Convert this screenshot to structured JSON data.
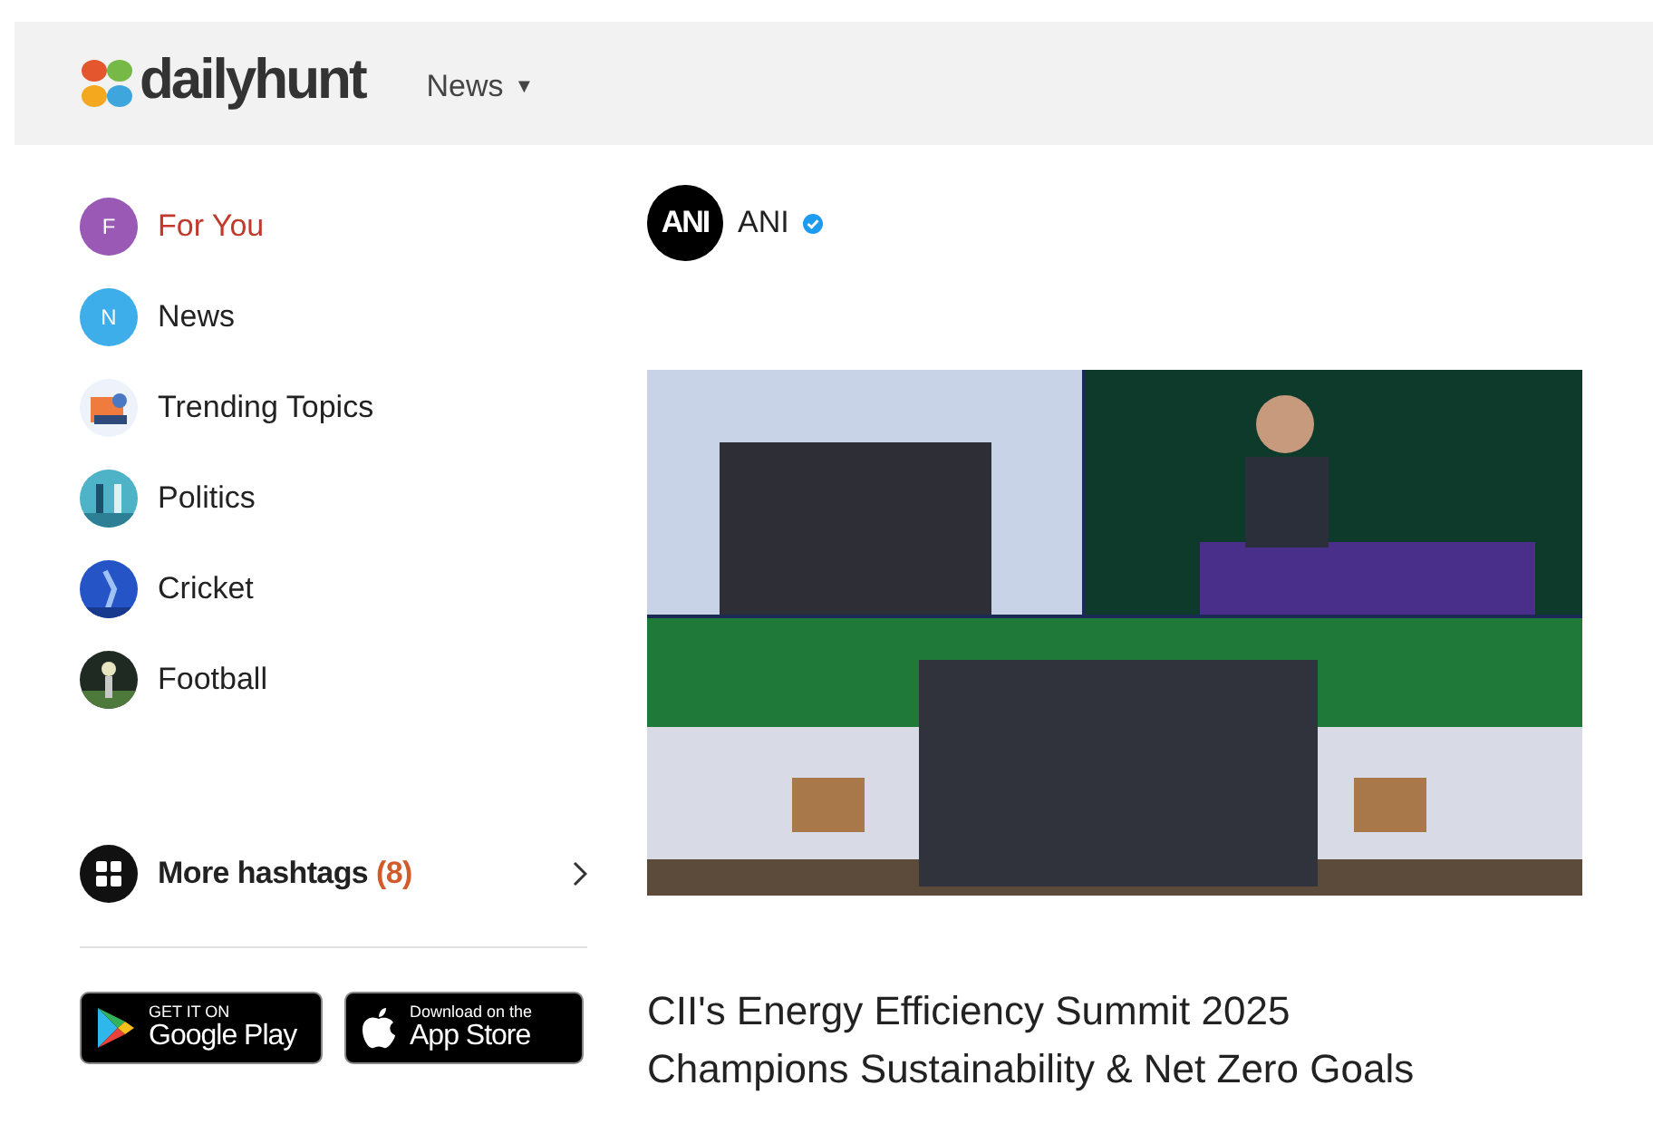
{
  "header": {
    "logo_text": "dailyhunt",
    "menu": {
      "label": "News",
      "caret": "▼"
    }
  },
  "sidebar": {
    "items": [
      {
        "kind": "letter",
        "letter": "F",
        "color": "#9b59b6",
        "label": "For You",
        "selected": true
      },
      {
        "kind": "letter",
        "letter": "N",
        "color": "#3daee9",
        "label": "News",
        "selected": false
      },
      {
        "label": "Trending Topics",
        "selected": false
      },
      {
        "label": "Politics",
        "selected": false
      },
      {
        "label": "Cricket",
        "selected": false
      },
      {
        "label": "Football",
        "selected": false
      }
    ],
    "more": {
      "label": "More hashtags",
      "count": "(8)"
    },
    "stores": [
      {
        "kind": "google",
        "small": "GET IT ON",
        "big": "Google Play"
      },
      {
        "kind": "apple",
        "small": "Download on the",
        "big": "App Store"
      }
    ]
  },
  "post": {
    "source": {
      "avatar_text": "ANI",
      "name": "ANI",
      "verified": true
    },
    "headline": "CII's Energy Efficiency Summit 2025 Champions Sustainability & Net Zero Goals"
  }
}
